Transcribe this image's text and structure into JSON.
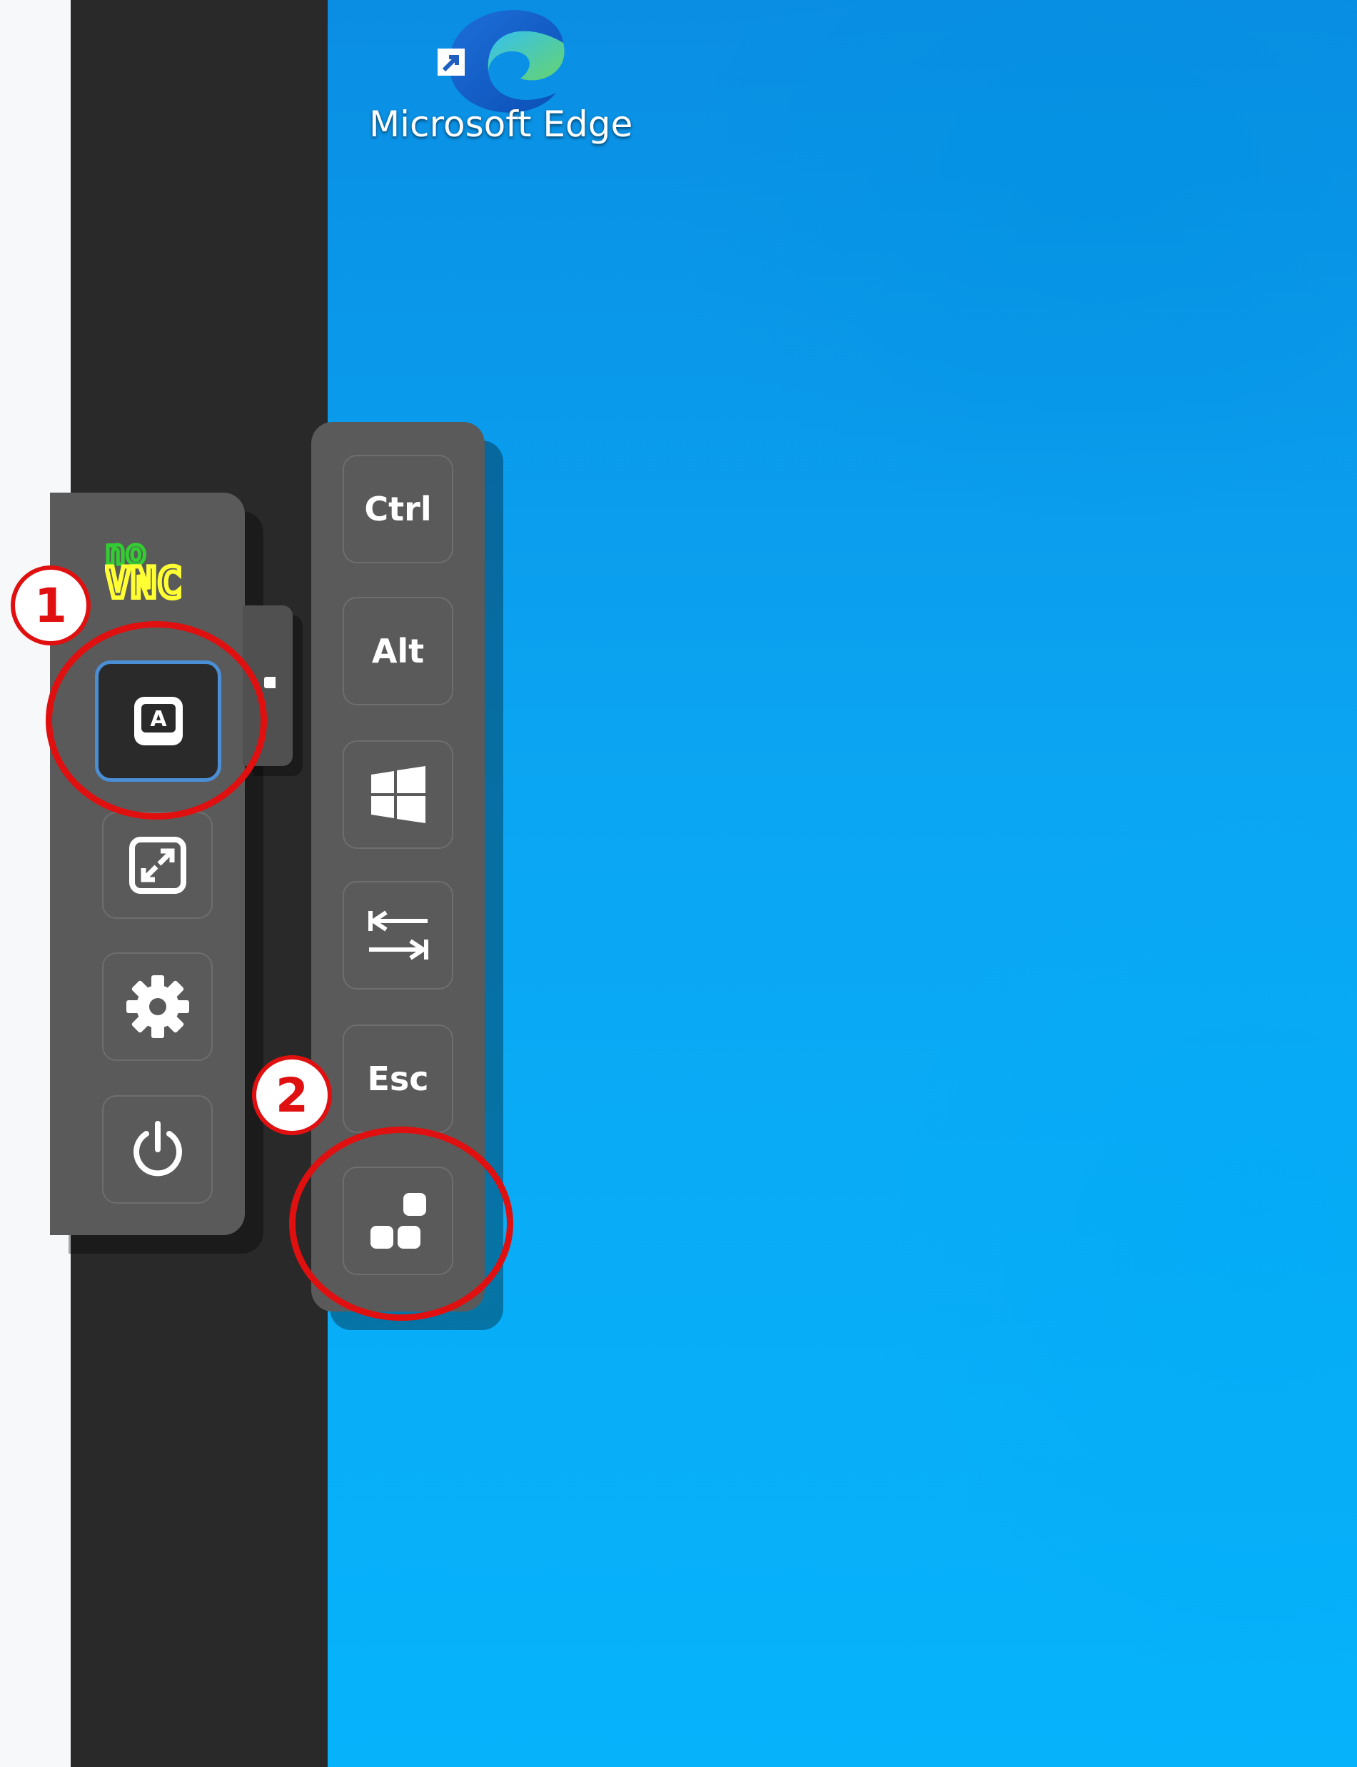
{
  "desktop": {
    "shortcut": {
      "label": "Microsoft Edge",
      "icon": "microsoft-edge-icon"
    }
  },
  "control_bar": {
    "logo": {
      "top": "no",
      "bottom": "VNC"
    },
    "buttons": [
      {
        "name": "extra-keys-toggle",
        "icon": "keyboard-a-icon",
        "active": true
      },
      {
        "name": "fullscreen",
        "icon": "fullscreen-icon"
      },
      {
        "name": "settings",
        "icon": "gear-icon"
      },
      {
        "name": "disconnect",
        "icon": "power-icon"
      }
    ]
  },
  "extra_keys": {
    "ctrl_label": "Ctrl",
    "alt_label": "Alt",
    "windows_icon": "windows-logo-icon",
    "tab_icon": "tab-icon",
    "esc_label": "Esc",
    "ctrl_alt_del_icon": "ctrl-alt-del-icon"
  },
  "annotations": [
    {
      "label": "1"
    },
    {
      "label": "2"
    }
  ],
  "colors": {
    "annotation": "#e01010",
    "panel": "#5a5a5a",
    "active_border": "#4a8fd6",
    "desktop_blue": "#0ba6f3",
    "logo_green": "#33cc33",
    "logo_yellow": "#ffff33"
  }
}
